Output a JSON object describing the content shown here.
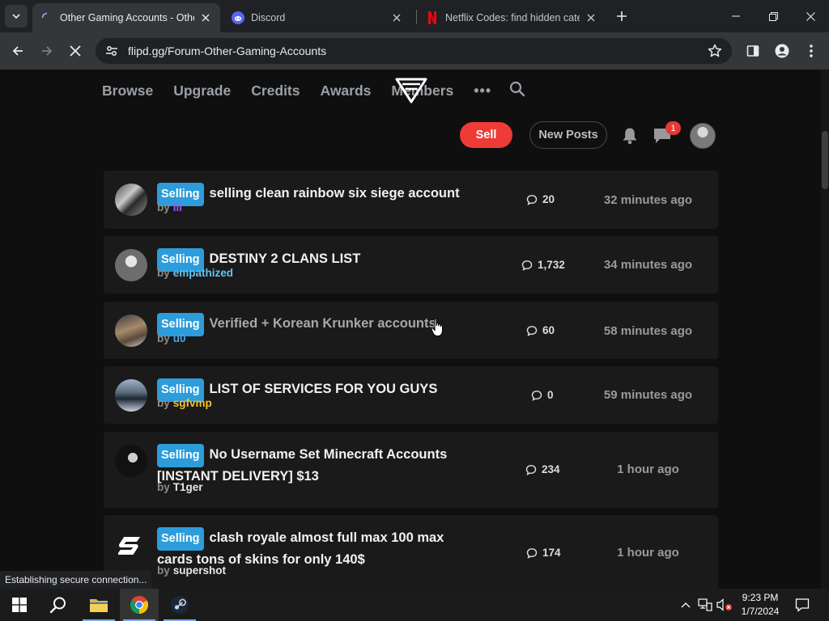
{
  "browser": {
    "tabs": [
      {
        "title": "Other Gaming Accounts - Other",
        "active": true
      },
      {
        "title": "Discord",
        "active": false
      },
      {
        "title": "Netflix Codes: find hidden categ",
        "active": false
      }
    ],
    "url": "flipd.gg/Forum-Other-Gaming-Accounts",
    "status": "Establishing secure connection..."
  },
  "site": {
    "nav": [
      "Browse",
      "Upgrade",
      "Credits",
      "Awards",
      "Members"
    ],
    "more": "•••",
    "sell_label": "Sell",
    "new_posts_label": "New Posts",
    "notif_count": "1"
  },
  "threads": [
    {
      "badge": "Selling",
      "title": "selling clean rainbow six siege account",
      "by": "by",
      "author": "lil",
      "author_color": "#9b59ff",
      "replies": "20",
      "time": "32 minutes ago"
    },
    {
      "badge": "Selling",
      "title": "DESTINY 2 CLANS LIST",
      "by": "by",
      "author": "empathized",
      "author_color": "#5fc3f5",
      "replies": "1,732",
      "time": "34 minutes ago"
    },
    {
      "badge": "Selling",
      "title": "Verified + Korean Krunker accounts",
      "by": "by",
      "author": "u0",
      "author_color": "#4aa3e8",
      "replies": "60",
      "time": "58 minutes ago"
    },
    {
      "badge": "Selling",
      "title": "LIST OF SERVICES FOR YOU GUYS",
      "by": "by",
      "author": "sgfvmp",
      "author_color": "#f2c230",
      "replies": "0",
      "time": "59 minutes ago"
    },
    {
      "badge": "Selling",
      "title": "No Username Set Minecraft Accounts [INSTANT DELIVERY] $13",
      "by": "by",
      "author": "T1ger",
      "author_color": "#e8e8e8",
      "replies": "234",
      "time": "1 hour ago"
    },
    {
      "badge": "Selling",
      "title": "clash royale almost full max 100 max cards tons of skins for only 140$",
      "by": "by",
      "author": "supershot",
      "author_color": "#e8e8e8",
      "replies": "174",
      "time": "1 hour ago"
    }
  ],
  "taskbar": {
    "time": "9:23 PM",
    "date": "1/7/2024"
  },
  "colors": {
    "sell": "#ee3b36",
    "badge": "#2d9cdb",
    "chrome_bg": "#202124",
    "toolbar_bg": "#35363a"
  },
  "icons": [
    "tab-search-icon",
    "spinner-icon",
    "discord-icon",
    "netflix-icon",
    "close-icon",
    "plus-icon",
    "minimize-icon",
    "restore-icon",
    "back-icon",
    "forward-icon",
    "stop-icon",
    "site-info-icon",
    "star-icon",
    "side-panel-icon",
    "profile-icon",
    "menu-icon",
    "search-icon",
    "bell-icon",
    "chat-icon",
    "reply-icon",
    "windows-icon",
    "folder-icon",
    "chrome-icon",
    "steam-icon",
    "chevron-up-icon",
    "network-icon",
    "volume-icon",
    "notification-icon"
  ]
}
